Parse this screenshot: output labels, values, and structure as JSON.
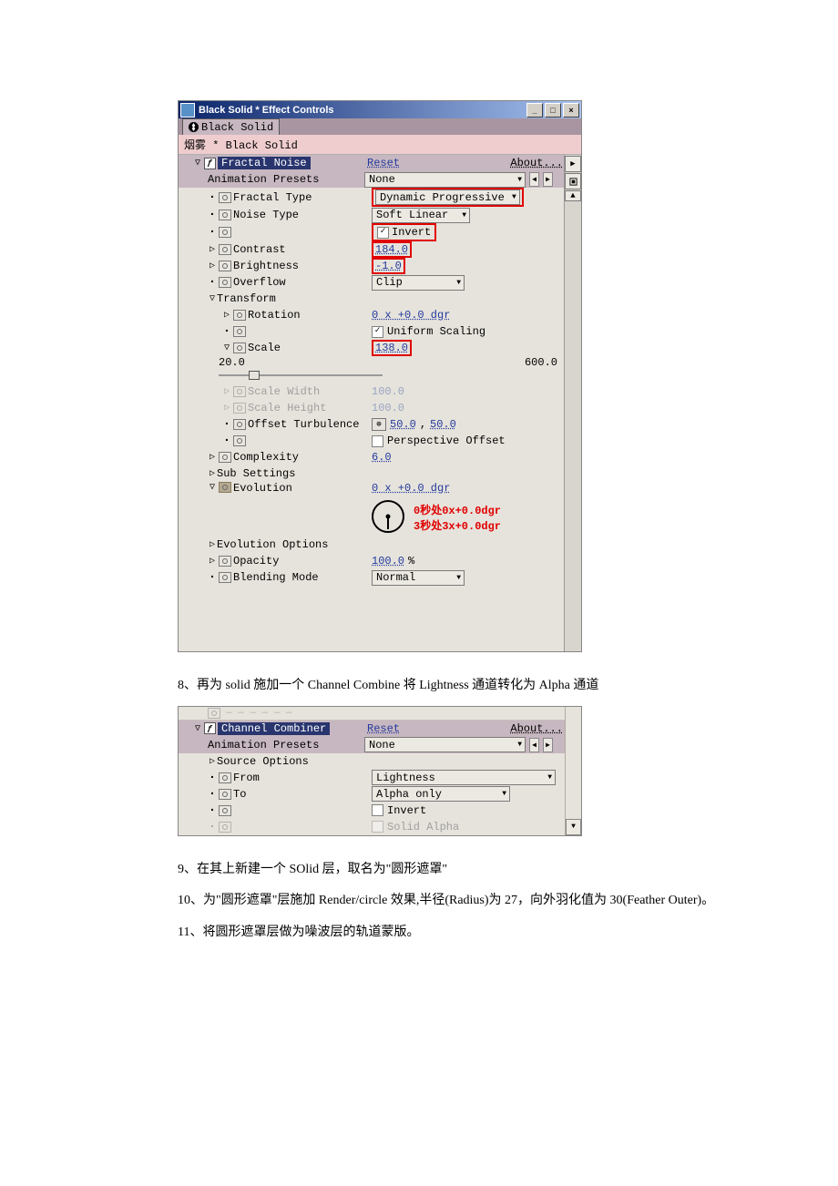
{
  "panel1": {
    "title": "Black Solid * Effect Controls",
    "winbtns": {
      "min": "_",
      "max": "□",
      "close": "×"
    },
    "tab": "Black Solid",
    "crumb": "烟雾 * Black Solid",
    "fxname": "Fractal Noise",
    "reset": "Reset",
    "about": "About...",
    "anim_presets_lbl": "Animation Presets",
    "anim_presets_val": "None",
    "fractal_type_lbl": "Fractal Type",
    "fractal_type_val": "Dynamic Progressive",
    "noise_type_lbl": "Noise Type",
    "noise_type_val": "Soft Linear",
    "invert_lbl": "Invert",
    "contrast_lbl": "Contrast",
    "contrast_val": "184.0",
    "brightness_lbl": "Brightness",
    "brightness_val": "-1.0",
    "overflow_lbl": "Overflow",
    "overflow_val": "Clip",
    "transform_lbl": "Transform",
    "rotation_lbl": "Rotation",
    "rotation_val": "0 x +0.0 dgr",
    "uniform_lbl": "Uniform Scaling",
    "scale_lbl": "Scale",
    "scale_val": "138.0",
    "scale_min": "20.0",
    "scale_max": "600.0",
    "scale_w_lbl": "Scale Width",
    "scale_w_val": "100.0",
    "scale_h_lbl": "Scale Height",
    "scale_h_val": "100.0",
    "offset_lbl": "Offset Turbulence",
    "offset_x": "50.0",
    "offset_y": "50.0",
    "persp_lbl": "Perspective Offset",
    "complexity_lbl": "Complexity",
    "complexity_val": "6.0",
    "subsettings_lbl": "Sub Settings",
    "evolution_lbl": "Evolution",
    "evolution_val": "0 x +0.0 dgr",
    "evo_note1": "0秒处0x+0.0dgr",
    "evo_note2": "3秒处3x+0.0dgr",
    "evo_opts_lbl": "Evolution Options",
    "opacity_lbl": "Opacity",
    "opacity_val": "100.0",
    "opacity_unit": "%",
    "blend_lbl": "Blending Mode",
    "blend_val": "Normal"
  },
  "text": {
    "t8": "8、再为 solid 施加一个 Channel Combine 将 Lightness 通道转化为 Alpha 通道",
    "t9": "9、在其上新建一个 SOlid 层，取名为\"圆形遮罩\"",
    "t10": "10、为\"圆形遮罩\"层施加 Render/circle 效果,半径(Radius)为 27，向外羽化值为 30(Feather Outer)。",
    "t11": "11、将圆形遮罩层做为噪波层的轨道蒙版。"
  },
  "panel2": {
    "cutoff": "— — — — — —",
    "fxname": "Channel Combiner",
    "reset": "Reset",
    "about": "About...",
    "anim_presets_lbl": "Animation Presets",
    "anim_presets_val": "None",
    "source_lbl": "Source Options",
    "from_lbl": "From",
    "from_val": "Lightness",
    "to_lbl": "To",
    "to_val": "Alpha only",
    "invert_lbl": "Invert",
    "solidalpha_lbl": "Solid Alpha"
  }
}
